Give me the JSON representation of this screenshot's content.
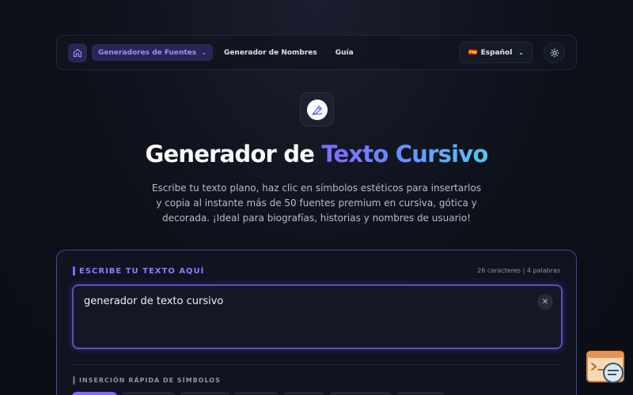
{
  "nav": {
    "dropdown_label": "Generadores de Fuentes",
    "links": [
      "Generador de Nombres",
      "Guía"
    ],
    "language_label": "Español",
    "language_flag": "🇪🇸"
  },
  "hero": {
    "title_plain": "Generador de ",
    "title_highlight": "Texto Cursivo",
    "description": "Escribe tu texto plano, haz clic en símbolos estéticos para insertarlos y copia al instante más de 50 fuentes premium en cursiva, gótica y decorada. ¡Ideal para biografías, historias y nombres de usuario!"
  },
  "editor": {
    "label": "ESCRIBE TU TEXTO AQUÍ",
    "counter": "26 caracteres | 4 palabras",
    "input_value": "generador de texto cursivo",
    "clear_glyph": "✕"
  },
  "symbols": {
    "label": "INSERCIÓN RÁPIDA DE SÍMBOLOS"
  },
  "colors": {
    "accent": "#7a69ff",
    "accent_dark": "#2b2553",
    "background": "#0c0f17"
  },
  "icons": [
    "home-icon",
    "chevron-down-icon",
    "sun-icon",
    "pen-logo-icon",
    "close-icon",
    "terminal-widget-icon"
  ]
}
